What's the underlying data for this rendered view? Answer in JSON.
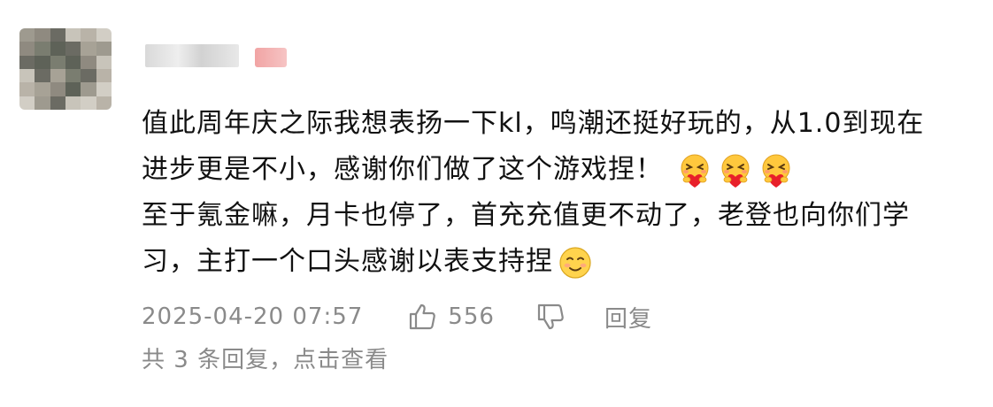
{
  "comment": {
    "lines": [
      "值此周年庆之际我想表扬一下kl，鸣潮还挺好玩的，从1.0到现在",
      "进步更是不小，感谢你们做了这个游戏捏！",
      "至于氪金嘛，月卡也停了，首充充值更不动了，老登也向你们学",
      "习，主打一个口头感谢以表支持捏"
    ],
    "line2_emojis": [
      "hug-heart-emoji",
      "hug-heart-emoji",
      "hug-heart-emoji"
    ],
    "line4_emoji": "shy-smile-emoji"
  },
  "meta": {
    "timestamp": "2025-04-20 07:57",
    "like_count": "556",
    "reply_label": "回复"
  },
  "replies": {
    "summary": "共 3 条回复，点击查看"
  },
  "icons": {
    "like": "thumbs-up-icon",
    "dislike": "thumbs-down-icon"
  },
  "colors": {
    "text": "#111111",
    "meta": "#8a8a8a"
  }
}
